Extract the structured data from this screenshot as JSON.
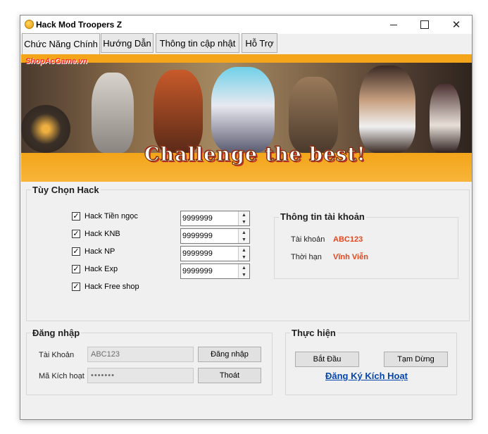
{
  "window": {
    "title": "Hack Mod Troopers Z",
    "controls": {
      "minimize_icon": "minimize-icon",
      "maximize_icon": "maximize-icon",
      "close_icon": "close-icon",
      "close_glyph": "✕"
    }
  },
  "tabs": [
    {
      "label": "Chức Năng Chính",
      "active": true
    },
    {
      "label": "Hướng Dẫn",
      "active": false
    },
    {
      "label": "Thông tin cập nhật",
      "active": false
    },
    {
      "label": "Hỗ Trợ",
      "active": false
    }
  ],
  "banner": {
    "watermark": "ShopAcGame.vn",
    "slogan": "Challenge the best!"
  },
  "hack_options": {
    "title": "Tùy Chọn Hack",
    "items": [
      {
        "label": "Hack Tiền ngọc",
        "checked": true,
        "value": "9999999"
      },
      {
        "label": "Hack KNB",
        "checked": true,
        "value": "9999999"
      },
      {
        "label": "Hack NP",
        "checked": true,
        "value": "9999999"
      },
      {
        "label": "Hack Exp",
        "checked": true,
        "value": "9999999"
      },
      {
        "label": "Hack Free shop",
        "checked": true
      }
    ],
    "check_glyph": "✓",
    "spin_up": "▲",
    "spin_down": "▼"
  },
  "account_info": {
    "title": "Thông tin tài khoản",
    "account_label": "Tài khoản",
    "account_value": "ABC123",
    "expiry_label": "Thời hạn",
    "expiry_value": "Vĩnh Viễn",
    "value_color": "#e2461d"
  },
  "login": {
    "title": "Đăng nhập",
    "account_label": "Tài Khoản",
    "account_value": "ABC123",
    "code_label": "Mã Kích hoạt",
    "code_value": "•••••••",
    "login_button": "Đăng nhập",
    "exit_button": "Thoát"
  },
  "actions": {
    "title": "Thực hiện",
    "start_button": "Bắt Đầu",
    "pause_button": "Tạm Dừng",
    "register_link": "Đăng Ký Kích Hoạt",
    "link_color": "#0645ad"
  }
}
